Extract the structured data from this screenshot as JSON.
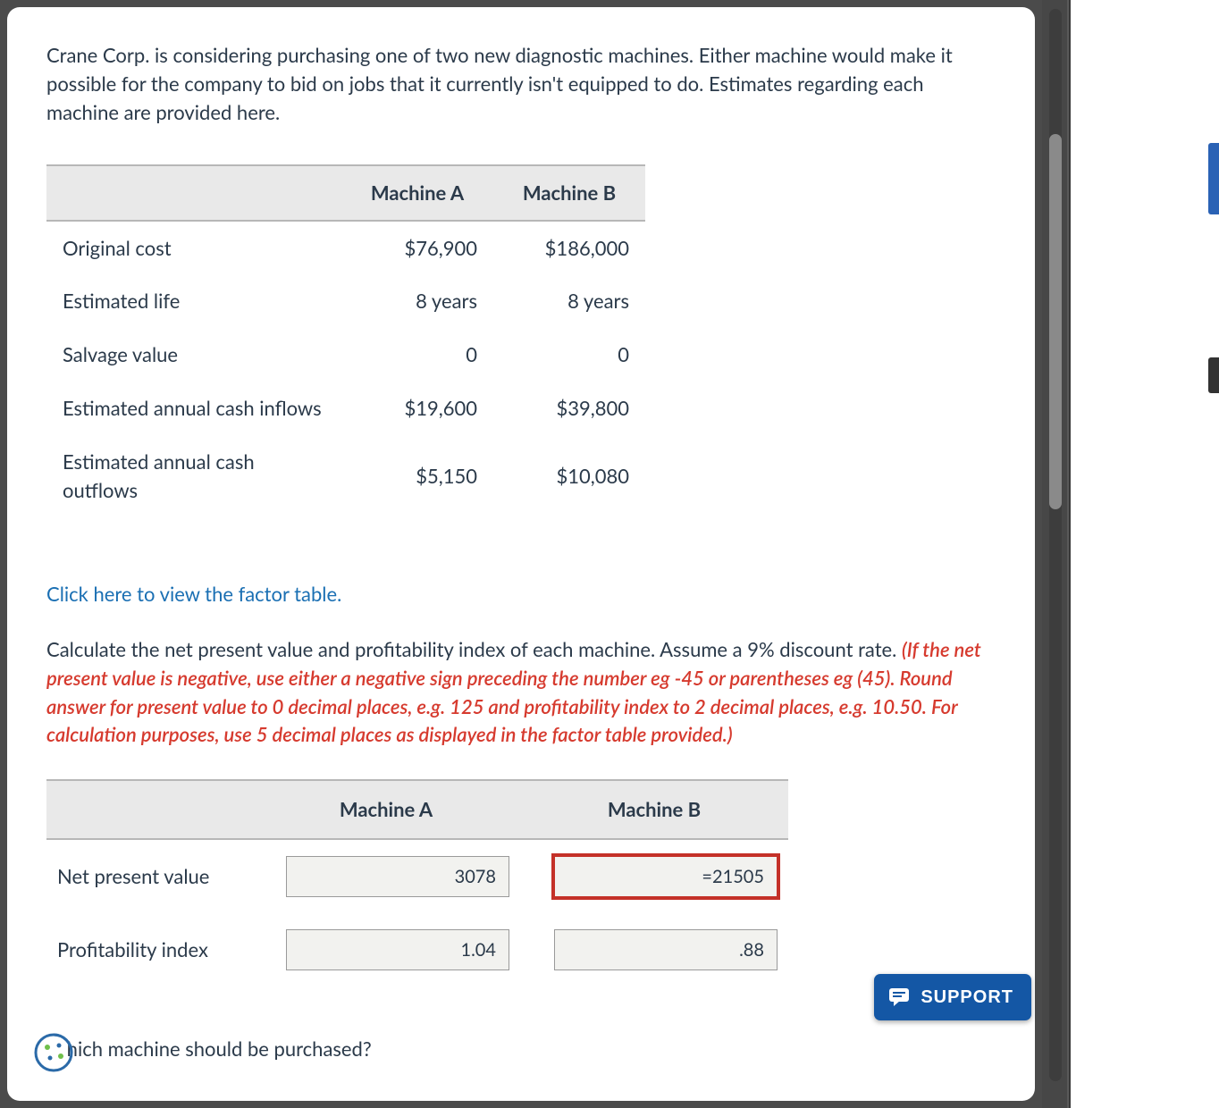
{
  "intro": "Crane Corp. is considering purchasing one of two new diagnostic machines. Either machine would make it possible for the company to bid on jobs that it currently isn't equipped to do. Estimates regarding each machine are provided here.",
  "est_table": {
    "headers": {
      "blank": "",
      "a": "Machine A",
      "b": "Machine B"
    },
    "rows": [
      {
        "label": "Original cost",
        "a": "$76,900",
        "b": "$186,000"
      },
      {
        "label": "Estimated life",
        "a": "8 years",
        "b": "8 years"
      },
      {
        "label": "Salvage value",
        "a": "0",
        "b": "0"
      },
      {
        "label": "Estimated annual cash inflows",
        "a": "$19,600",
        "b": "$39,800"
      },
      {
        "label": "Estimated annual cash outflows",
        "a": "$5,150",
        "b": "$10,080"
      }
    ]
  },
  "factor_link": "Click here to view the factor table.",
  "question_lead": "Calculate the net present value and profitability index of each machine. Assume a 9% discount rate. ",
  "question_hint": "(If the net present value is negative, use either a negative sign preceding the number eg -45 or parentheses eg (45). Round answer for present value to 0 decimal places, e.g. 125 and profitability index to 2 decimal places, e.g. 10.50. For calculation purposes, use 5 decimal places as displayed in the factor table provided.)",
  "answer_table": {
    "headers": {
      "blank": "",
      "a": "Machine A",
      "b": "Machine B"
    },
    "rows": [
      {
        "label": "Net present value",
        "a_value": "3078",
        "b_value": "=21505",
        "b_error": true
      },
      {
        "label": "Profitability index",
        "a_value": "1.04",
        "b_value": ".88",
        "b_error": false
      }
    ]
  },
  "final_question": "hich machine should be purchased?",
  "support_label": "SUPPORT"
}
